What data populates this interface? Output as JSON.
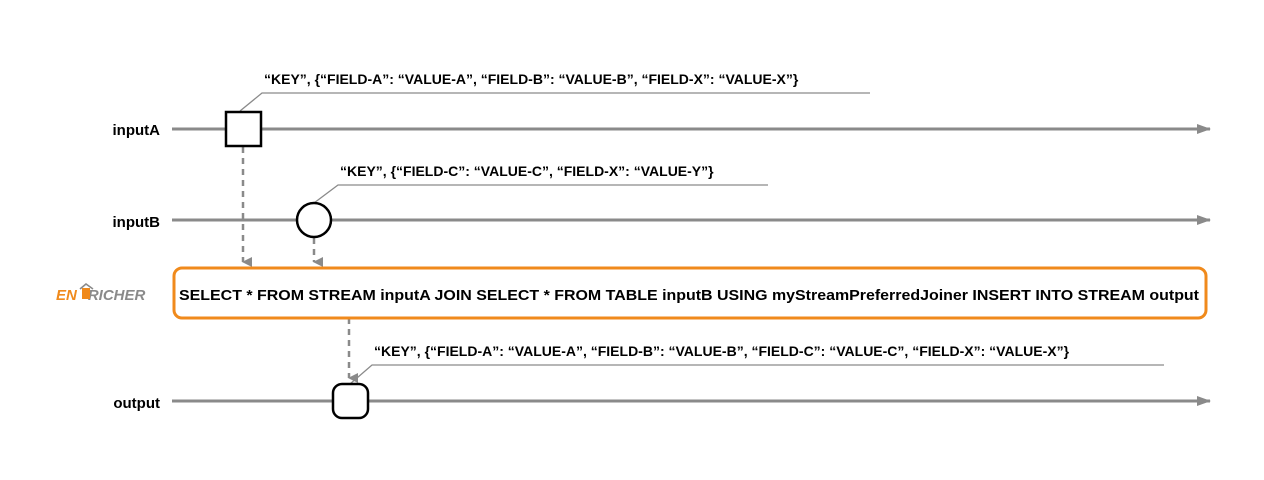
{
  "streams": {
    "inputA": {
      "label": "inputA"
    },
    "inputB": {
      "label": "inputB"
    },
    "output": {
      "label": "output"
    }
  },
  "events": {
    "inputA": "“KEY”, {“FIELD-A”: “VALUE-A”, “FIELD-B”: “VALUE-B”, “FIELD-X”: “VALUE-X”}",
    "inputB": "“KEY”, {“FIELD-C”: “VALUE-C”, “FIELD-X”: “VALUE-Y”}",
    "output": "“KEY”, {“FIELD-A”: “VALUE-A”, “FIELD-B”: “VALUE-B”, “FIELD-C”: “VALUE-C”, “FIELD-X”: “VALUE-X”}"
  },
  "operator": {
    "query": "SELECT * FROM STREAM inputA JOIN SELECT * FROM TABLE inputB USING myStreamPreferredJoiner INSERT INTO STREAM output",
    "logo": {
      "part1": "EN",
      "part2": "RICHER"
    }
  },
  "colors": {
    "operator_border": "#f08a1c",
    "timeline": "#8a8a8a",
    "logo_accent": "#f08a1c",
    "logo_gray": "#8a8a8a"
  }
}
